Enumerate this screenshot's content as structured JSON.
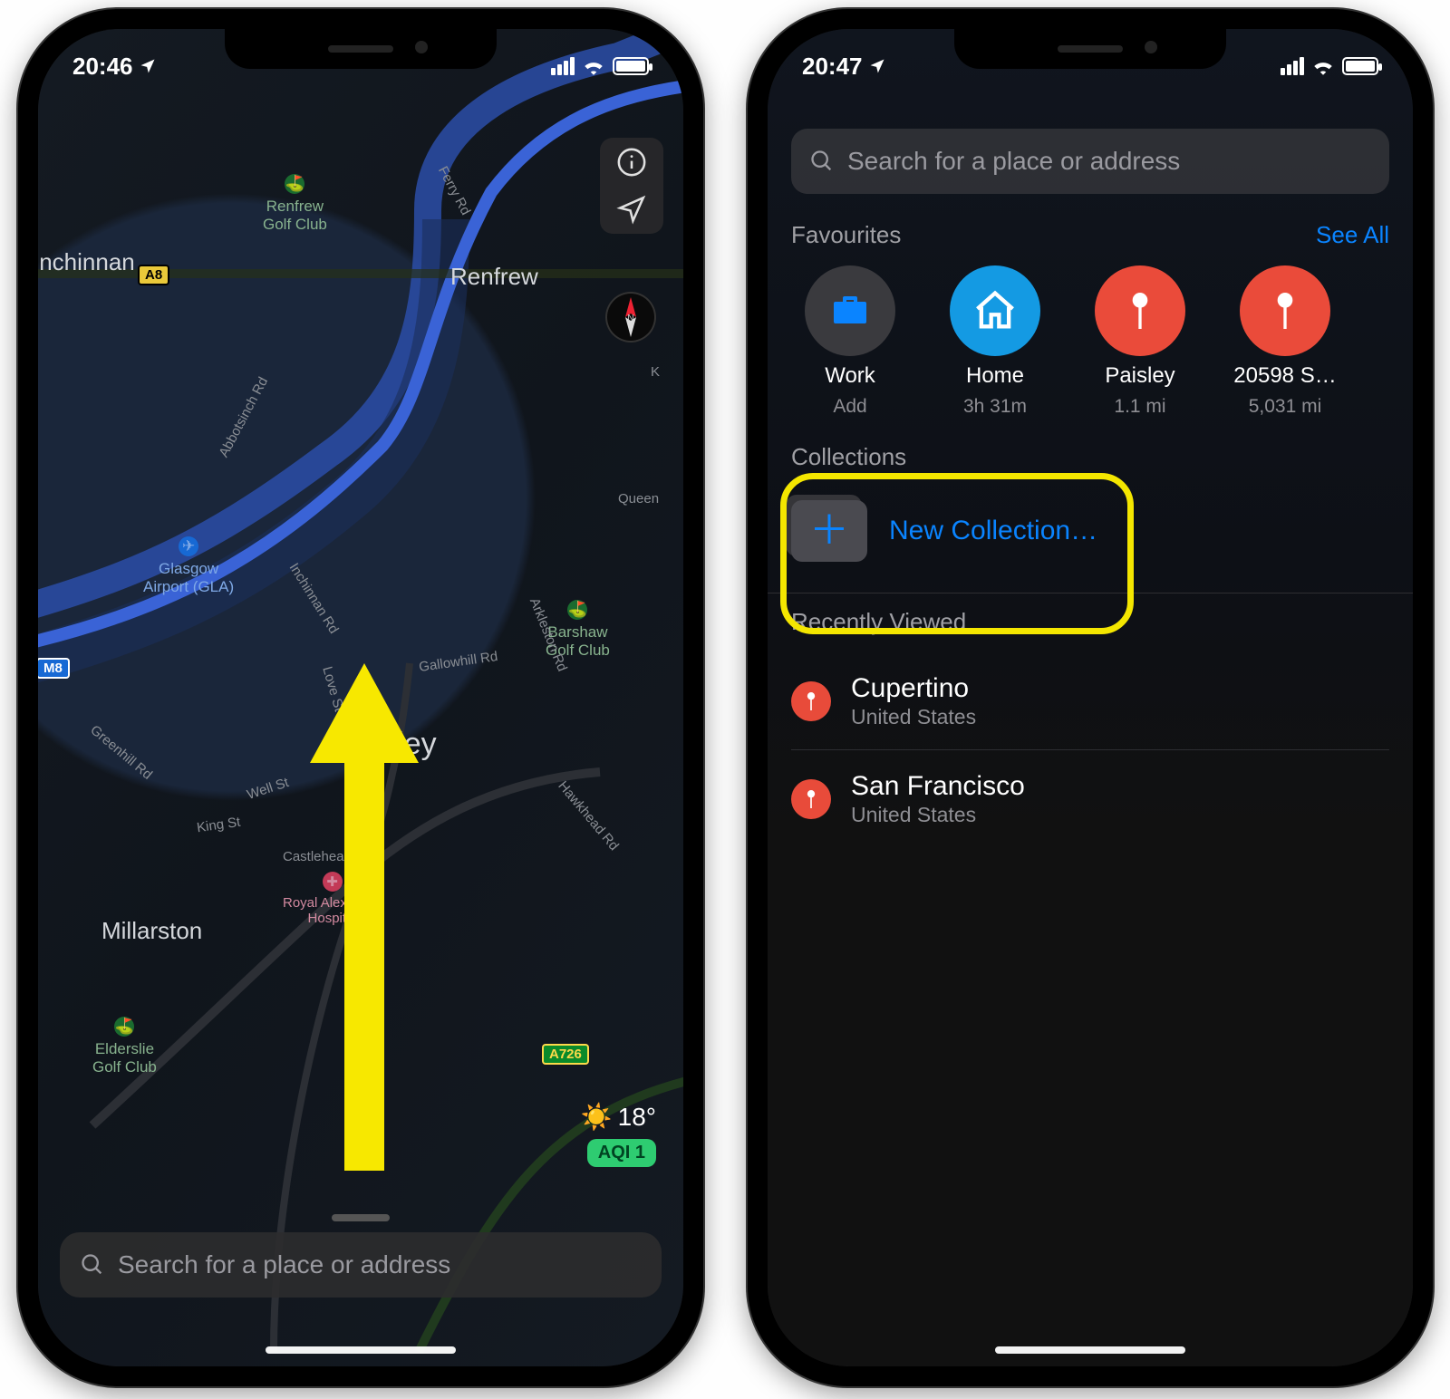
{
  "left": {
    "status_time": "20:46",
    "search_placeholder": "Search for a place or address",
    "weather": {
      "temp": "18°",
      "aqi_label": "AQI 1"
    },
    "map": {
      "cities": {
        "inchinnan": "Inchinnan",
        "renfrew": "Renfrew",
        "paisley": "Paisley",
        "millarston": "Millarston"
      },
      "pois": {
        "renfrew_golf": "Renfrew\nGolf Club",
        "barshaw_golf": "Barshaw\nGolf Club",
        "elderslie_golf": "Elderslie\nGolf Club",
        "glasgow_airport": "Glasgow\nAirport (GLA)",
        "hospital": "Royal Alexandra\nHospital"
      },
      "signs": {
        "a8": "A8",
        "a726": "A726",
        "m8": "M8"
      },
      "roads": {
        "ferry": "Ferry Rd",
        "abbotsinch": "Abbotsinch Rd",
        "inchinnan": "Inchinnan Rd",
        "greenhill": "Greenhill Rd",
        "love": "Love St",
        "well": "Well St",
        "king": "King St",
        "castlehead": "Castlehead",
        "gallowhill": "Gallowhill Rd",
        "arkleston": "Arkleston Rd",
        "hawkhead": "Hawkhead Rd",
        "queen": "Queen",
        "k": "K"
      }
    }
  },
  "right": {
    "status_time": "20:47",
    "search_placeholder": "Search for a place or address",
    "favourites_label": "Favourites",
    "see_all": "See All",
    "favourites": [
      {
        "title": "Work",
        "sub": "Add",
        "kind": "briefcase",
        "color": "grey"
      },
      {
        "title": "Home",
        "sub": "3h 31m",
        "kind": "house",
        "color": "blue"
      },
      {
        "title": "Paisley",
        "sub": "1.1 mi",
        "kind": "pin",
        "color": "red"
      },
      {
        "title": "20598 S…",
        "sub": "5,031 mi",
        "kind": "pin",
        "color": "red"
      }
    ],
    "collections_label": "Collections",
    "new_collection": "New Collection…",
    "recently_label": "Recently Viewed",
    "recent": [
      {
        "title": "Cupertino",
        "sub": "United States"
      },
      {
        "title": "San Francisco",
        "sub": "United States"
      }
    ]
  }
}
